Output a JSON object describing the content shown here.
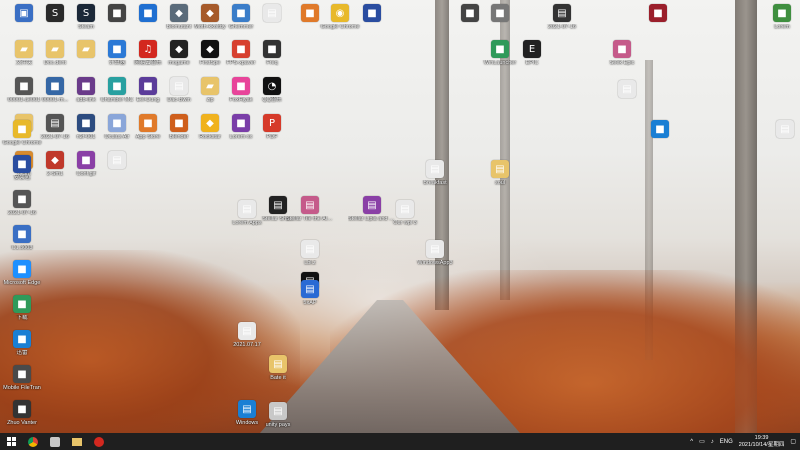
{
  "desktop_icons": [
    {
      "label": "",
      "color": "#3a6fc4",
      "symbol": "computer-icon"
    },
    {
      "label": "",
      "color": "#2a2a2a",
      "symbol": "steam-icon"
    },
    {
      "label": "Steam",
      "color": "#1b2838",
      "symbol": "steam-icon"
    },
    {
      "label": "",
      "color": "#444",
      "symbol": "app-icon"
    },
    {
      "label": "",
      "color": "#1f6fd1",
      "symbol": "app-icon"
    },
    {
      "label": "Biomutant",
      "color": "#5a6b7a",
      "symbol": "game-icon"
    },
    {
      "label": "Moth-kkoltdy",
      "color": "#a65a2a",
      "symbol": "game-icon"
    },
    {
      "label": "Ghemmer",
      "color": "#3a7dc9",
      "symbol": "app-icon"
    },
    {
      "label": "",
      "color": "#e9e9e9",
      "symbol": "file-icon"
    },
    {
      "label": "文件夹",
      "color": "#e8c46a",
      "symbol": "folder-icon"
    },
    {
      "label": "Doc.dent",
      "color": "#e8c46a",
      "symbol": "folder-icon"
    },
    {
      "label": "",
      "color": "#e8c46a",
      "symbol": "folder-icon"
    },
    {
      "label": "计算器",
      "color": "#2b79d6",
      "symbol": "app-icon"
    },
    {
      "label": "网易云音乐",
      "color": "#d3281f",
      "symbol": "music-icon"
    },
    {
      "label": "mogame",
      "color": "#222",
      "symbol": "game-icon"
    },
    {
      "label": "FirstSpe",
      "color": "#111",
      "symbol": "game-icon"
    },
    {
      "label": "FPS-xpaver",
      "color": "#d7402f",
      "symbol": "app-icon"
    },
    {
      "label": "Freq",
      "color": "#333",
      "symbol": "app-icon"
    },
    {
      "label": "00001-ae001",
      "color": "#555",
      "symbol": "app-icon"
    },
    {
      "label": "00001-m...",
      "color": "#3567a5",
      "symbol": "app-icon"
    },
    {
      "label": "adb-link",
      "color": "#6a3b8a",
      "symbol": "app-icon"
    },
    {
      "label": "Chamber MC",
      "color": "#28a0a0",
      "symbol": "app-icon"
    },
    {
      "label": "Eel-Dung",
      "color": "#5b3c9a",
      "symbol": "app-icon"
    },
    {
      "label": "Dac-Bwin",
      "color": "#e9e9e9",
      "symbol": "file-icon"
    },
    {
      "label": "zip",
      "color": "#e8c46a",
      "symbol": "folder-icon"
    },
    {
      "label": "FoxHiyak",
      "color": "#e8449a",
      "symbol": "app-icon"
    },
    {
      "label": "QQ音乐",
      "color": "#111",
      "symbol": "qq-icon"
    },
    {
      "label": "",
      "color": "#e8c46a",
      "symbol": "folder-icon"
    },
    {
      "label": "2021-07-16",
      "color": "#555",
      "symbol": "file-icon"
    },
    {
      "label": "n2f-001",
      "color": "#2d4c80",
      "symbol": "app-icon"
    },
    {
      "label": "Oculus Air",
      "color": "#8aa6d9",
      "symbol": "app-icon"
    },
    {
      "label": "App Store",
      "color": "#e07a2a",
      "symbol": "app-icon"
    },
    {
      "label": "Blender",
      "color": "#cf5f1c",
      "symbol": "app-icon"
    },
    {
      "label": "Rockstar",
      "color": "#f0b21e",
      "symbol": "game-icon"
    },
    {
      "label": "Lorem xx",
      "color": "#7a3ea8",
      "symbol": "app-icon"
    },
    {
      "label": "PDF",
      "color": "#d63a2a",
      "symbol": "pdf-icon"
    },
    {
      "label": "Z-Sm",
      "color": "#d88b2f",
      "symbol": "game-icon"
    },
    {
      "label": "2-Sm1",
      "color": "#c0392b",
      "symbol": "game-icon"
    },
    {
      "label": "Conf.gif",
      "color": "#8a3fa6",
      "symbol": "app-icon"
    },
    {
      "label": "",
      "color": "#e9e9e9",
      "symbol": "file-icon"
    },
    {
      "label": "",
      "color": "#e07a2a",
      "symbol": "app-icon"
    },
    {
      "label": "Google Chrome",
      "color": "#e8b92a",
      "symbol": "chrome-icon"
    },
    {
      "label": "",
      "color": "#2a4da0",
      "symbol": "app-icon"
    },
    {
      "label": "",
      "color": "#444",
      "symbol": "app-icon"
    },
    {
      "label": "",
      "color": "#777",
      "symbol": "app-icon"
    },
    {
      "label": "2021-07-16",
      "color": "#333",
      "symbol": "file-icon"
    },
    {
      "label": "",
      "color": "#9b1f2b",
      "symbol": "app-icon"
    },
    {
      "label": "Lorem",
      "color": "#3f8f3f",
      "symbol": "app-icon"
    },
    {
      "label": "WinLauncher",
      "color": "#2f9a5a",
      "symbol": "app-icon"
    },
    {
      "label": "EPIC",
      "color": "#222",
      "symbol": "epic-icon"
    },
    {
      "label": "Seek Epic",
      "color": "#c55a8a",
      "symbol": "app-icon"
    },
    {
      "label": "",
      "color": "#e9e9e9",
      "symbol": "file-icon"
    },
    {
      "label": "",
      "color": "#e9e9e9",
      "symbol": "file-icon"
    },
    {
      "label": "",
      "color": "#1a7fd4",
      "symbol": "app-icon"
    }
  ],
  "left_column_labels": [
    "Google Chrome",
    "安装包",
    "2021-07-16",
    "C1.3003",
    "Microsoft Edge",
    "下载",
    "迅雷",
    "Mobile FileTran",
    "Zhuo Vanter"
  ],
  "mid_labels": [
    "Lorem Apps",
    "Stellar Sho...",
    "Stellar Tile the Alum",
    "Stellar Lipla and Somb",
    "Breakfast",
    "soul",
    "Our wpl 3",
    "Lbl.z",
    "ample",
    "WindowsApp3",
    "5xAP",
    "Bate it",
    "2021.07.17",
    "unity pays",
    "Windows"
  ],
  "taskbar": {
    "start": "windows-icon",
    "pinned": [
      "chrome-icon",
      "game-icon",
      "folder-icon",
      "music-icon"
    ],
    "tray": {
      "lang": "ENG",
      "time": "19:39",
      "date": "2021/10/14/星期四"
    }
  }
}
